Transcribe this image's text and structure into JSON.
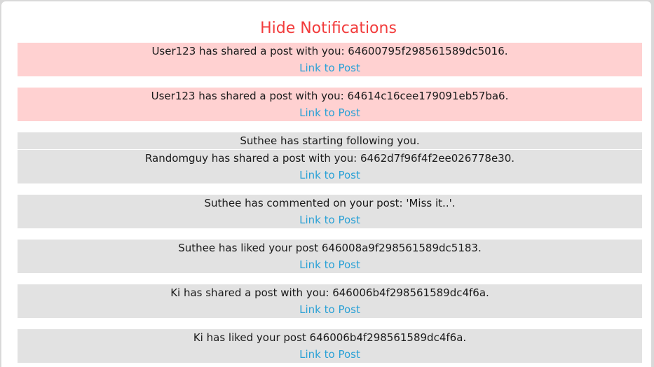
{
  "header": {
    "title": "Hide Notifications",
    "title_color": "#f23c3c"
  },
  "colors": {
    "unread_bg": "#ffd1d1",
    "read_bg": "#e2e2e2",
    "link": "#2aa1d6"
  },
  "notifications": [
    {
      "message": "User123 has shared a post with you: 64600795f298561589dc5016.",
      "link": "Link to Post",
      "state": "unread"
    },
    {
      "message": "User123 has shared a post with you: 64614c16cee179091eb57ba6.",
      "link": "Link to Post",
      "state": "unread"
    },
    {
      "message": "Suthee has starting following you.",
      "state": "read"
    },
    {
      "message": "Randomguy has shared a post with you: 6462d7f96f4f2ee026778e30.",
      "link": "Link to Post",
      "state": "read"
    },
    {
      "message": "Suthee has commented on your post: 'Miss it..'.",
      "link": "Link to Post",
      "state": "read"
    },
    {
      "message": "Suthee has liked your post 646008a9f298561589dc5183.",
      "link": "Link to Post",
      "state": "read"
    },
    {
      "message": "Ki has shared a post with you: 646006b4f298561589dc4f6a.",
      "link": "Link to Post",
      "state": "read"
    },
    {
      "message": "Ki has liked your post 646006b4f298561589dc4f6a.",
      "link": "Link to Post",
      "state": "read"
    }
  ]
}
